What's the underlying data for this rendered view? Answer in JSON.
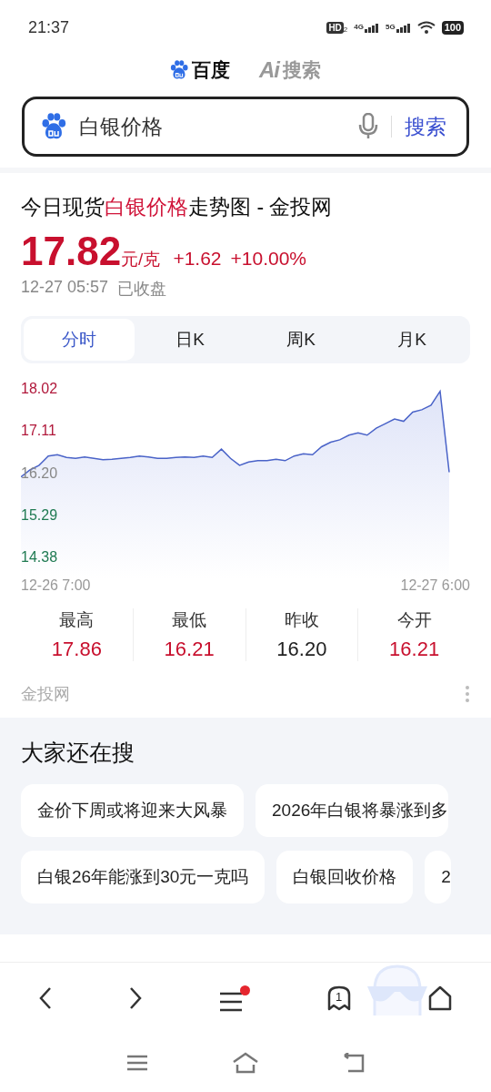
{
  "status_bar": {
    "time": "21:37",
    "hd": "HD",
    "hd_sub": "2",
    "net1": "4G",
    "net2": "5G",
    "battery": "100"
  },
  "brand_tabs": [
    {
      "label": "百度",
      "kind": "baidu",
      "selected": true
    },
    {
      "label": "搜索",
      "kind": "ai",
      "prefix": "Ai",
      "selected": false
    }
  ],
  "search": {
    "value": "白银价格",
    "button": "搜索"
  },
  "result": {
    "title": {
      "before": "今日现货",
      "highlight": "白银价格",
      "after": "走势图 - 金投网"
    },
    "price": "17.82",
    "unit": "元/克",
    "change": "+1.62",
    "change_pct": "+10.00%",
    "time": "12-27 05:57",
    "market_status": "已收盘",
    "tabs": [
      {
        "label": "分时",
        "selected": true
      },
      {
        "label": "日K",
        "selected": false
      },
      {
        "label": "周K",
        "selected": false
      },
      {
        "label": "月K",
        "selected": false
      }
    ],
    "x_start_label": "12-26 7:00",
    "x_end_label": "12-27 6:00",
    "chart_data": {
      "type": "area",
      "ylim": [
        14.38,
        18.02
      ],
      "yticks": [
        18.02,
        17.11,
        {
          "value": 16.2,
          "label": "16.20"
        },
        15.29,
        14.38
      ],
      "series": [
        {
          "color": "#4a63c8",
          "values": [
            16.1,
            16.25,
            16.35,
            16.55,
            16.58,
            16.52,
            16.5,
            16.53,
            16.5,
            16.47,
            16.48,
            16.5,
            16.52,
            16.55,
            16.53,
            16.5,
            16.5,
            16.52,
            16.53,
            16.52,
            16.55,
            16.52,
            16.7,
            16.5,
            16.35,
            16.42,
            16.45,
            16.45,
            16.48,
            16.45,
            16.55,
            16.6,
            16.58,
            16.75,
            16.85,
            16.9,
            17.0,
            17.05,
            17.0,
            17.15,
            17.25,
            17.35,
            17.3,
            17.5,
            17.55,
            17.65,
            17.95,
            16.2
          ]
        }
      ]
    },
    "stats": [
      {
        "label": "最高",
        "value": "17.86",
        "kind": "up"
      },
      {
        "label": "最低",
        "value": "16.21",
        "kind": "up"
      },
      {
        "label": "昨收",
        "value": "16.20",
        "kind": "flat"
      },
      {
        "label": "今开",
        "value": "16.21",
        "kind": "up"
      }
    ],
    "source": "金投网"
  },
  "related": {
    "heading": "大家还在搜",
    "rows": [
      [
        "金价下周或将迎来大风暴",
        "2026年白银将暴涨到多"
      ],
      [
        "白银26年能涨到30元一克吗",
        "白银回收价格",
        "2"
      ]
    ]
  },
  "toolbar": {
    "tab_count": "1",
    "menu_notification": true
  }
}
